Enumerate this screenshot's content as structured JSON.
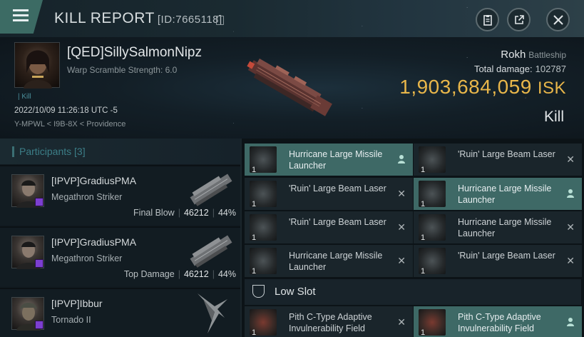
{
  "header": {
    "title": "KILL REPORT",
    "report_id": "[ID:7665118]"
  },
  "victim": {
    "name": "[QED]SillySalmonNipz",
    "warp_scramble": "Warp Scramble Strength: 6.0",
    "kill_tag": "Kill",
    "datetime": "2022/10/09 11:26:18 UTC -5",
    "location": "Y-MPWL < I9B-8X < Providence",
    "ship_name": "Rokh",
    "ship_class": "Battleship",
    "total_damage_label": "Total damage:",
    "total_damage": "102787",
    "isk_value": "1,903,684,059",
    "isk_unit": "ISK",
    "outcome": "Kill"
  },
  "participants": {
    "label": "Participants",
    "count": "[3]",
    "rows": [
      {
        "name": "[IPVP]GradiusPMA",
        "ship": "Megathron Striker",
        "role": "Final Blow",
        "damage": "46212",
        "percent": "44%"
      },
      {
        "name": "[IPVP]GradiusPMA",
        "ship": "Megathron Striker",
        "role": "Top Damage",
        "damage": "46212",
        "percent": "44%"
      },
      {
        "name": "[IPVP]Ibbur",
        "ship": "Tornado II",
        "role": "",
        "damage": "",
        "percent": ""
      }
    ]
  },
  "fitting": {
    "slots": [
      {
        "qty": "1",
        "name": "Hurricane Large Missile Launcher",
        "state": "dropped",
        "icon": "missile-launcher-icon"
      },
      {
        "qty": "1",
        "name": "'Ruin' Large Beam Laser",
        "state": "destroyed",
        "icon": "beam-laser-icon"
      },
      {
        "qty": "1",
        "name": "'Ruin' Large Beam Laser",
        "state": "destroyed",
        "icon": "beam-laser-icon"
      },
      {
        "qty": "1",
        "name": "Hurricane Large Missile Launcher",
        "state": "dropped",
        "icon": "missile-launcher-icon"
      },
      {
        "qty": "1",
        "name": "'Ruin' Large Beam Laser",
        "state": "destroyed",
        "icon": "beam-laser-icon"
      },
      {
        "qty": "1",
        "name": "Hurricane Large Missile Launcher",
        "state": "destroyed",
        "icon": "missile-launcher-icon"
      },
      {
        "qty": "1",
        "name": "Hurricane Large Missile Launcher",
        "state": "destroyed",
        "icon": "missile-launcher-icon"
      },
      {
        "qty": "1",
        "name": "'Ruin' Large Beam Laser",
        "state": "destroyed",
        "icon": "beam-laser-icon"
      }
    ],
    "low_slot_label": "Low Slot",
    "low_slots": [
      {
        "qty": "1",
        "name": "Pith C-Type Adaptive Invulnerability Field",
        "state": "destroyed",
        "icon": "shield-hardener-icon"
      },
      {
        "qty": "1",
        "name": "Pith C-Type Adaptive Invulnerability Field",
        "state": "dropped",
        "icon": "shield-hardener-icon"
      }
    ]
  },
  "colors": {
    "accent": "#3e6966",
    "isk": "#e8b64a",
    "corp_badge": "#7c3fd0"
  }
}
